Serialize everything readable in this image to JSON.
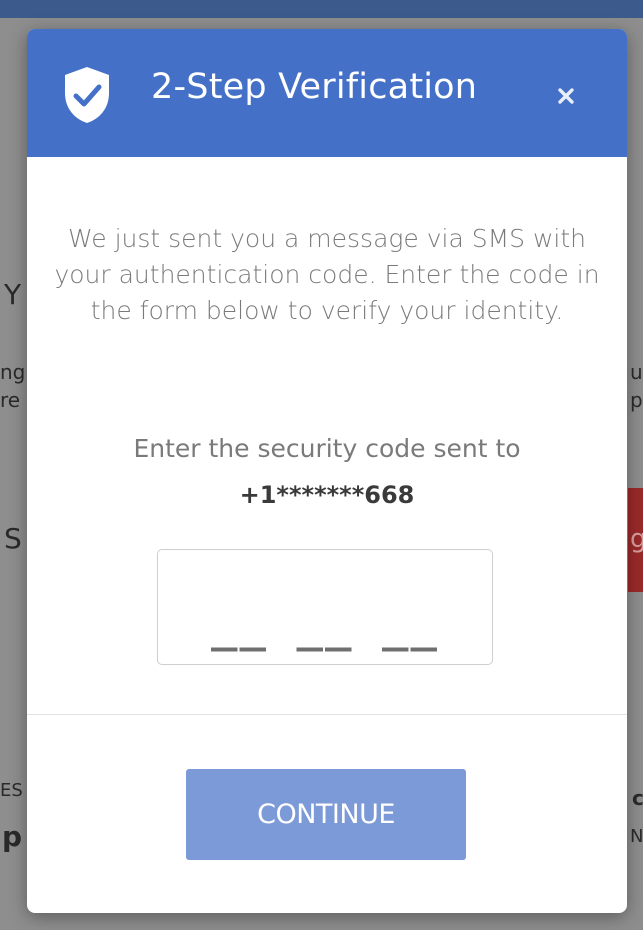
{
  "background": {
    "fragments": [
      "Y",
      "ng",
      "re",
      "S",
      "ur",
      "pl",
      "g",
      "ES",
      "p",
      "c",
      "N"
    ]
  },
  "modal": {
    "title": "2-Step Verification",
    "close_symbol": "×",
    "message": "We just sent you a message via SMS with your authentication code. Enter the code in the form below to verify your identity.",
    "code_prompt": "Enter the security code sent to",
    "phone_masked": "+1*******668",
    "code_input": {
      "placeholder": "__ __ __",
      "value": ""
    },
    "continue_label": "CONTINUE"
  },
  "colors": {
    "header": "#4470c8",
    "button": "#7d9ad8",
    "body_text": "#7a7a7a"
  },
  "icons": {
    "header": "shield-check-icon",
    "close": "close-icon"
  }
}
